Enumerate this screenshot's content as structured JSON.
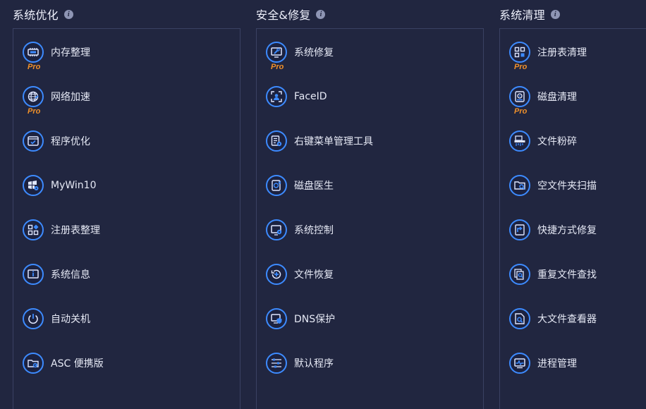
{
  "columns": [
    {
      "title": "系统优化",
      "items": [
        {
          "label": "内存整理",
          "icon": "memory-chip-icon",
          "pro": true
        },
        {
          "label": "网络加速",
          "icon": "globe-icon",
          "pro": true
        },
        {
          "label": "程序优化",
          "icon": "window-check-icon",
          "pro": false
        },
        {
          "label": "MyWin10",
          "icon": "windows-gear-icon",
          "pro": false
        },
        {
          "label": "注册表整理",
          "icon": "registry-blocks-icon",
          "pro": false
        },
        {
          "label": "系统信息",
          "icon": "info-monitor-icon",
          "pro": false
        },
        {
          "label": "自动关机",
          "icon": "power-icon",
          "pro": false
        },
        {
          "label": "ASC 便携版",
          "icon": "portable-folder-icon",
          "pro": false
        }
      ]
    },
    {
      "title": "安全&修复",
      "items": [
        {
          "label": "系统修复",
          "icon": "monitor-wrench-icon",
          "pro": true
        },
        {
          "label": "FaceID",
          "icon": "face-scan-icon",
          "pro": false
        },
        {
          "label": "右键菜单管理工具",
          "icon": "menu-gear-icon",
          "pro": false
        },
        {
          "label": "磁盘医生",
          "icon": "disk-doctor-icon",
          "pro": false
        },
        {
          "label": "系统控制",
          "icon": "monitor-gear-icon",
          "pro": false
        },
        {
          "label": "文件恢复",
          "icon": "restore-icon",
          "pro": false
        },
        {
          "label": "DNS保护",
          "icon": "dns-shield-icon",
          "pro": false
        },
        {
          "label": "默认程序",
          "icon": "sliders-icon",
          "pro": false
        }
      ]
    },
    {
      "title": "系统清理",
      "items": [
        {
          "label": "注册表清理",
          "icon": "registry-clean-icon",
          "pro": true
        },
        {
          "label": "磁盘清理",
          "icon": "disk-clean-icon",
          "pro": true
        },
        {
          "label": "文件粉碎",
          "icon": "shredder-icon",
          "pro": false
        },
        {
          "label": "空文件夹扫描",
          "icon": "folder-search-icon",
          "pro": false
        },
        {
          "label": "快捷方式修复",
          "icon": "shortcut-icon",
          "pro": false
        },
        {
          "label": "重复文件查找",
          "icon": "duplicate-search-icon",
          "pro": false
        },
        {
          "label": "大文件查看器",
          "icon": "large-file-icon",
          "pro": false
        },
        {
          "label": "进程管理",
          "icon": "process-monitor-icon",
          "pro": false
        }
      ]
    }
  ],
  "pro_badge": "Pro",
  "info_glyph": "i",
  "colors": {
    "background": "#212640",
    "accent": "#3d8bff",
    "pro": "#f0902a",
    "border": "#3a4163"
  }
}
